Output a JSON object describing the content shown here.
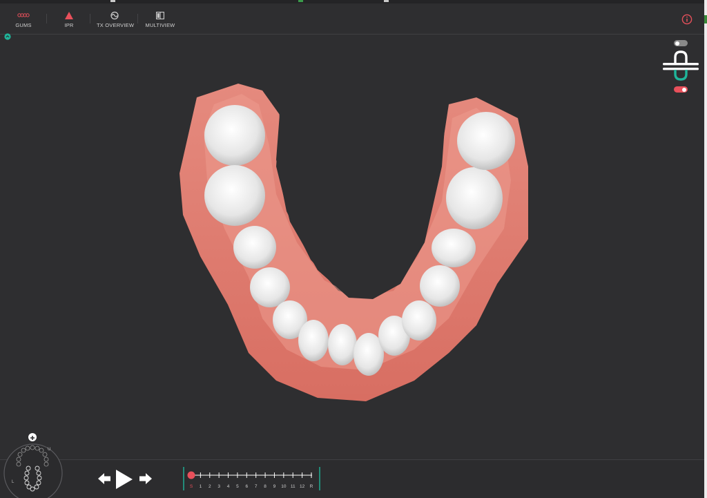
{
  "toolbar": {
    "items": [
      {
        "label": "GUMS",
        "icon": "gums-icon"
      },
      {
        "label": "IPR",
        "icon": "ipr-triangle-icon"
      },
      {
        "label": "TX OVERVIEW",
        "icon": "tx-overview-icon"
      },
      {
        "label": "MULTIVIEW",
        "icon": "multiview-icon"
      }
    ],
    "info_icon": "info-icon"
  },
  "arch_selector": {
    "upper_toggle": "off",
    "lower_toggle": "on",
    "upper_color": "#ffffff",
    "lower_color": "#1fb59a",
    "on_color": "#e8505b"
  },
  "minimap": {
    "label_u": "U",
    "label_l": "L",
    "add_icon": "plus-icon"
  },
  "playback": {
    "prev_icon": "arrow-left-icon",
    "play_icon": "play-icon",
    "next_icon": "arrow-right-icon"
  },
  "timeline": {
    "steps": [
      "S",
      "1",
      "2",
      "3",
      "4",
      "5",
      "6",
      "7",
      "8",
      "9",
      "10",
      "11",
      "12",
      "R"
    ],
    "current_step": "S",
    "current_color": "#e8505b",
    "accent_color": "#1fb59a"
  },
  "colors": {
    "background": "#2e2e30",
    "gum": "#e27c70",
    "tooth": "#efefef",
    "alert": "#e8505b"
  }
}
